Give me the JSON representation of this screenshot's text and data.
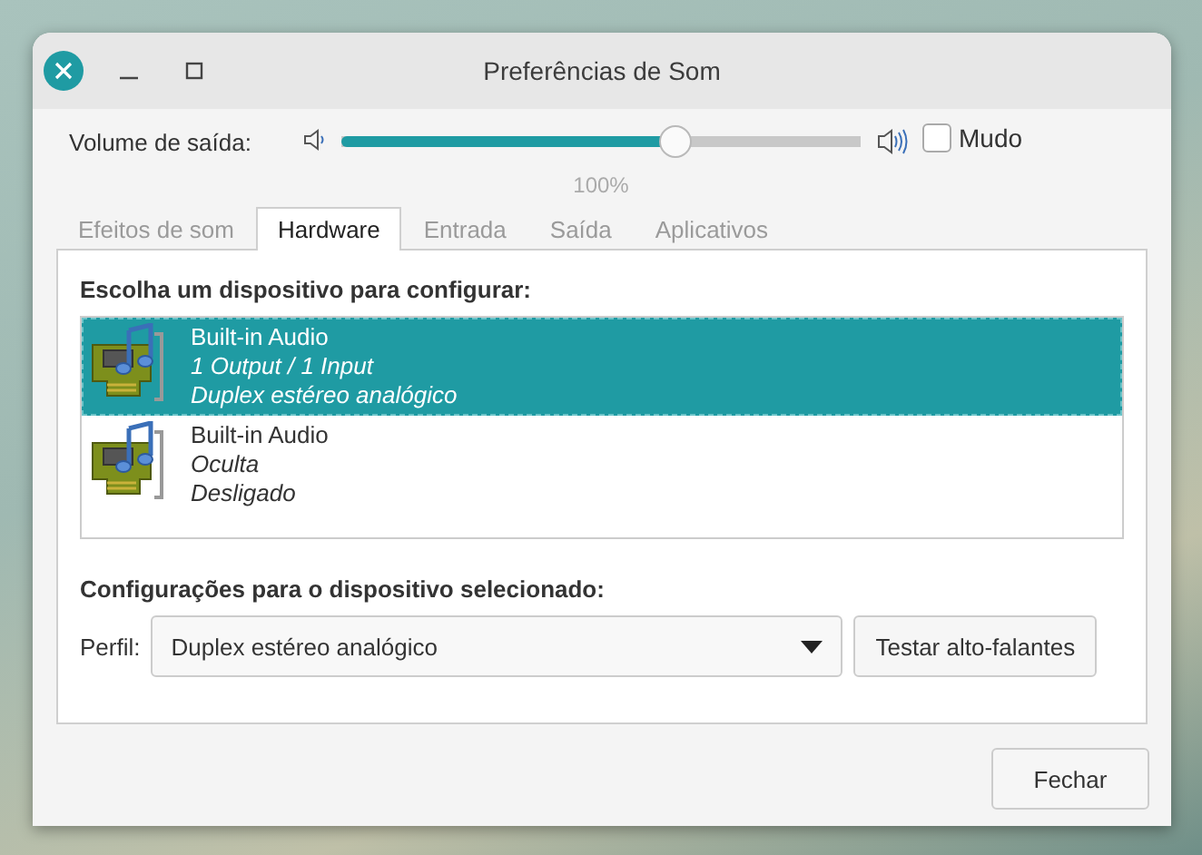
{
  "window": {
    "title": "Preferências de Som"
  },
  "volume": {
    "label": "Volume de saída:",
    "level": 0.645,
    "reading": "100%",
    "mute": {
      "label": "Mudo",
      "checked": false
    }
  },
  "tabs": [
    {
      "label": "Efeitos de som",
      "selected": false
    },
    {
      "label": "Hardware",
      "selected": true
    },
    {
      "label": "Entrada",
      "selected": false
    },
    {
      "label": "Saída",
      "selected": false
    },
    {
      "label": "Aplicativos",
      "selected": false
    }
  ],
  "device_list": {
    "heading": "Escolha um dispositivo para configurar:",
    "devices": [
      {
        "name": "Built-in Audio",
        "details": [
          "1 Output / 1 Input",
          "Duplex estéreo analógico"
        ],
        "selected": true
      },
      {
        "name": "Built-in Audio",
        "details": [
          "Oculta",
          "Desligado"
        ],
        "selected": false
      }
    ]
  },
  "settings": {
    "heading": "Configurações para o dispositivo selecionado:",
    "profile_label": "Perfil:",
    "profile": "Duplex estéreo analógico",
    "test_button": "Testar alto-falantes"
  },
  "buttons": [
    "Fechar"
  ]
}
